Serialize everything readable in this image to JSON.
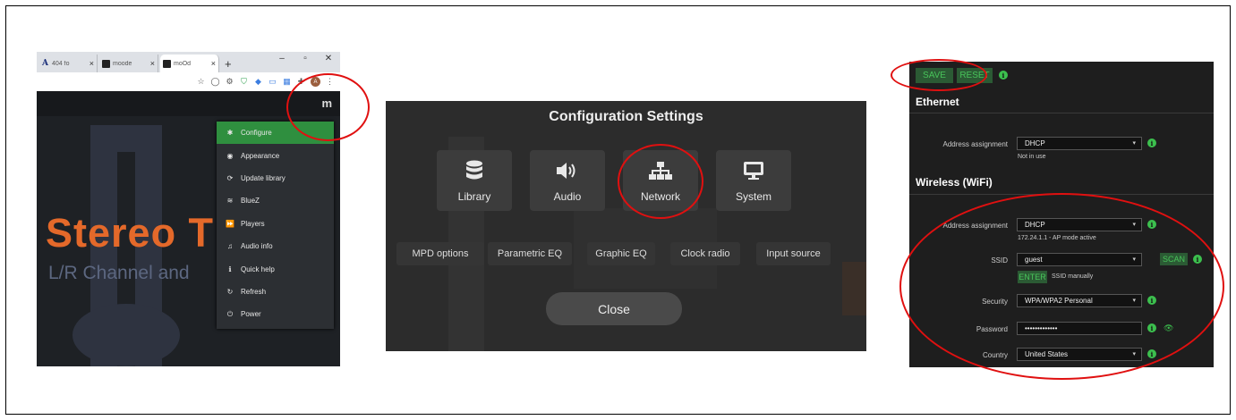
{
  "browser": {
    "tabs": [
      {
        "icon": "A",
        "title": "404 fo",
        "close": "×"
      },
      {
        "icon": "",
        "title": "moode",
        "close": "×"
      },
      {
        "icon": "",
        "title": "moOd",
        "close": "×"
      }
    ],
    "new_tab": "+",
    "window_controls": [
      "–",
      "▫",
      "✕"
    ],
    "app_logo": "m",
    "background_title": "Stereo T",
    "background_subtitle": "L/R Channel and",
    "menu": [
      {
        "label": "Configure",
        "icon": "gear-icon",
        "glyph": "✱",
        "active": true
      },
      {
        "label": "Appearance",
        "icon": "eye-icon",
        "glyph": "◉",
        "active": false
      },
      {
        "label": "Update library",
        "icon": "refresh-icon",
        "glyph": "⟳",
        "active": false
      },
      {
        "label": "BlueZ",
        "icon": "wifi-icon",
        "glyph": "≋",
        "active": false
      },
      {
        "label": "Players",
        "icon": "forward-icon",
        "glyph": "⏩",
        "active": false
      },
      {
        "label": "Audio info",
        "icon": "music-icon",
        "glyph": "♫",
        "active": false
      },
      {
        "label": "Quick help",
        "icon": "info-icon",
        "glyph": "ℹ",
        "active": false
      },
      {
        "label": "Refresh",
        "icon": "redo-icon",
        "glyph": "↻",
        "active": false
      },
      {
        "label": "Power",
        "icon": "power-icon",
        "glyph": "⏻",
        "active": false
      }
    ]
  },
  "config": {
    "title": "Configuration Settings",
    "tiles": [
      {
        "label": "Library",
        "icon": "database-icon"
      },
      {
        "label": "Audio",
        "icon": "speaker-icon"
      },
      {
        "label": "Network",
        "icon": "network-icon"
      },
      {
        "label": "System",
        "icon": "monitor-icon"
      }
    ],
    "buttons": [
      "MPD options",
      "Parametric EQ",
      "Graphic EQ",
      "Clock radio",
      "Input source"
    ],
    "close_label": "Close"
  },
  "network": {
    "save_label": "SAVE",
    "reset_label": "RESET",
    "ethernet_title": "Ethernet",
    "eth_addr_label": "Address assignment",
    "eth_addr_value": "DHCP",
    "eth_note": "Not in use",
    "wifi_title": "Wireless (WiFi)",
    "wifi_addr_label": "Address assignment",
    "wifi_addr_value": "DHCP",
    "wifi_addr_note": "172.24.1.1 - AP mode active",
    "ssid_label": "SSID",
    "ssid_value": "guest",
    "scan_label": "SCAN",
    "enter_label": "ENTER",
    "enter_note": "SSID manually",
    "security_label": "Security",
    "security_value": "WPA/WPA2 Personal",
    "password_label": "Password",
    "password_value": "•••••••••••••",
    "country_label": "Country",
    "country_value": "United States",
    "accent_color": "#3cc04e"
  },
  "annotation_color": "#e01010"
}
